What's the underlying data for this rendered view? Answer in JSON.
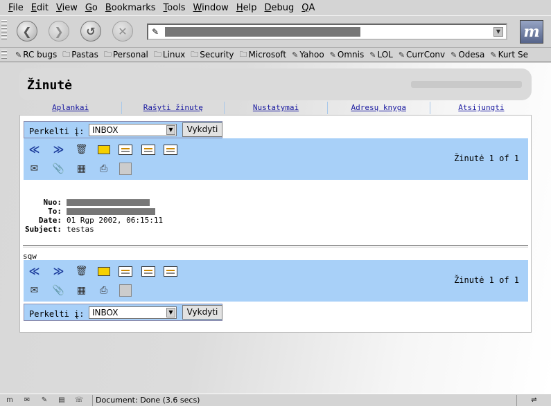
{
  "menu": [
    {
      "u": "F",
      "rest": "ile"
    },
    {
      "u": "E",
      "rest": "dit"
    },
    {
      "u": "V",
      "rest": "iew"
    },
    {
      "u": "G",
      "rest": "o"
    },
    {
      "u": "B",
      "rest": "ookmarks"
    },
    {
      "u": "T",
      "rest": "ools"
    },
    {
      "u": "W",
      "rest": "indow"
    },
    {
      "u": "H",
      "rest": "elp"
    },
    {
      "u": "D",
      "rest": "ebug"
    },
    {
      "u": "Q",
      "rest": "A"
    }
  ],
  "bookmarks": [
    {
      "label": "RC bugs",
      "icon": "bookmark-icon"
    },
    {
      "label": "Pastas",
      "icon": "folder-icon"
    },
    {
      "label": "Personal",
      "icon": "folder-icon"
    },
    {
      "label": "Linux",
      "icon": "folder-icon"
    },
    {
      "label": "Security",
      "icon": "folder-icon"
    },
    {
      "label": "Microsoft",
      "icon": "folder-icon"
    },
    {
      "label": "Yahoo",
      "icon": "bookmark-icon"
    },
    {
      "label": "Omnis",
      "icon": "bookmark-icon"
    },
    {
      "label": "LOL",
      "icon": "bookmark-icon"
    },
    {
      "label": "CurrConv",
      "icon": "bookmark-icon"
    },
    {
      "label": "Odesa",
      "icon": "bookmark-icon"
    },
    {
      "label": "Kurt Se",
      "icon": "bookmark-icon"
    }
  ],
  "page": {
    "title": "Žinutė",
    "nav": [
      "Aplankai",
      "Rašyti žinutę",
      "Nustatymai",
      "Adresų knyga",
      "Atsijungti"
    ],
    "move_label": "Perkelti į:",
    "move_value": "INBOX",
    "move_button": "Vykdyti",
    "message_count": "Žinutė 1 of 1",
    "headers": {
      "from_label": "Nuo:",
      "to_label": "To:",
      "date_label": "Date:",
      "date_value": "01 Rgp 2002, 06:15:11",
      "subject_label": "Subject:",
      "subject_value": "testas"
    },
    "body": "sqw"
  },
  "status": {
    "text": "Document: Done (3.6 secs)"
  },
  "colors": {
    "toolbar_blue": "#a8d0f8",
    "link": "#1a1aa0"
  }
}
